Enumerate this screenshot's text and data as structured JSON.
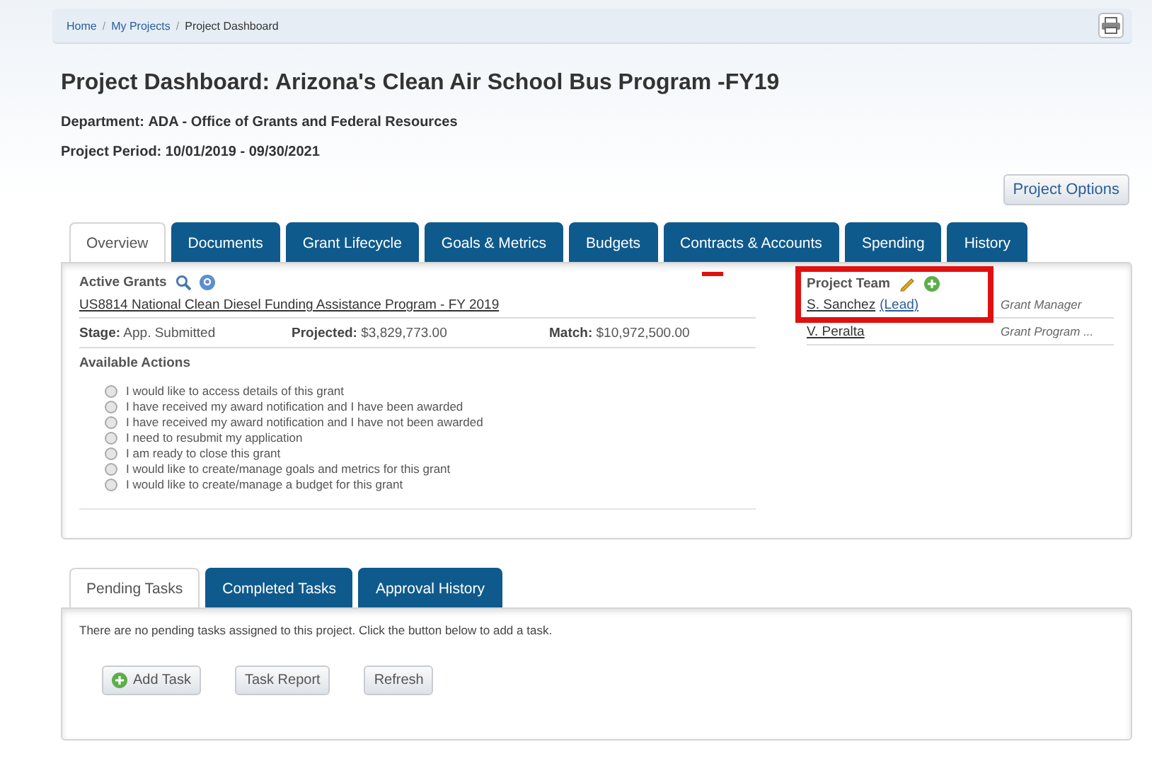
{
  "breadcrumb": [
    {
      "label": "Home",
      "link": true
    },
    {
      "separator": "/"
    },
    {
      "label": "My Projects",
      "link": true
    },
    {
      "separator": "/"
    },
    {
      "label": "Project Dashboard",
      "link": false
    }
  ],
  "title": "Project Dashboard: Arizona's Clean Air School Bus Program -FY19",
  "department": {
    "label": "Department:",
    "value": "ADA - Office of Grants and Federal Resources"
  },
  "period": {
    "label": "Project Period:",
    "value": "10/01/2019 - 09/30/2021"
  },
  "options_button": "Project Options",
  "tabs": [
    {
      "label": "Overview",
      "selected": true
    },
    {
      "label": "Documents",
      "selected": false
    },
    {
      "label": "Grant Lifecycle",
      "selected": false
    },
    {
      "label": "Goals & Metrics",
      "selected": false
    },
    {
      "label": "Budgets",
      "selected": false
    },
    {
      "label": "Contracts & Accounts",
      "selected": false
    },
    {
      "label": "Spending",
      "selected": false
    },
    {
      "label": "History",
      "selected": false
    }
  ],
  "active_grants": {
    "heading": "Active Grants",
    "grant": "US8814 National Clean Diesel Funding Assistance Program - FY 2019",
    "stage": {
      "label": "Stage:",
      "value": "App. Submitted"
    },
    "projected": {
      "label": "Projected:",
      "value": "$3,829,773.00"
    },
    "match": {
      "label": "Match:",
      "value": "$10,972,500.00"
    }
  },
  "available_actions": {
    "heading": "Available Actions",
    "options": [
      {
        "label": "I would like to access details of this grant",
        "selected": false
      },
      {
        "label": "I have received my award notification and I have been awarded",
        "selected": false
      },
      {
        "label": "I have received my award notification and I have not been awarded",
        "selected": false
      },
      {
        "label": "I need to resubmit my application",
        "selected": false
      },
      {
        "label": "I am ready to close this grant",
        "selected": false
      },
      {
        "label": "I would like to create/manage goals and metrics for this grant",
        "selected": false
      },
      {
        "label": "I would like to create/manage a budget for this grant",
        "selected": false
      }
    ]
  },
  "project_team": {
    "heading": "Project Team",
    "members": [
      {
        "name": "S. Sanchez",
        "lead": "(Lead)",
        "role": "Grant Manager"
      },
      {
        "name": "V. Peralta",
        "role": "Grant Program ..."
      }
    ]
  },
  "task_tabs": [
    {
      "label": "Pending Tasks",
      "selected": true
    },
    {
      "label": "Completed Tasks",
      "selected": false
    },
    {
      "label": "Approval History",
      "selected": false
    }
  ],
  "tasks_message": "There are no pending tasks assigned to this project. Click the button below to add a task.",
  "task_buttons": [
    {
      "label": "Add Task",
      "kind": "add"
    },
    {
      "label": "Task Report",
      "kind": "plain"
    },
    {
      "label": "Refresh",
      "kind": "plain"
    }
  ]
}
